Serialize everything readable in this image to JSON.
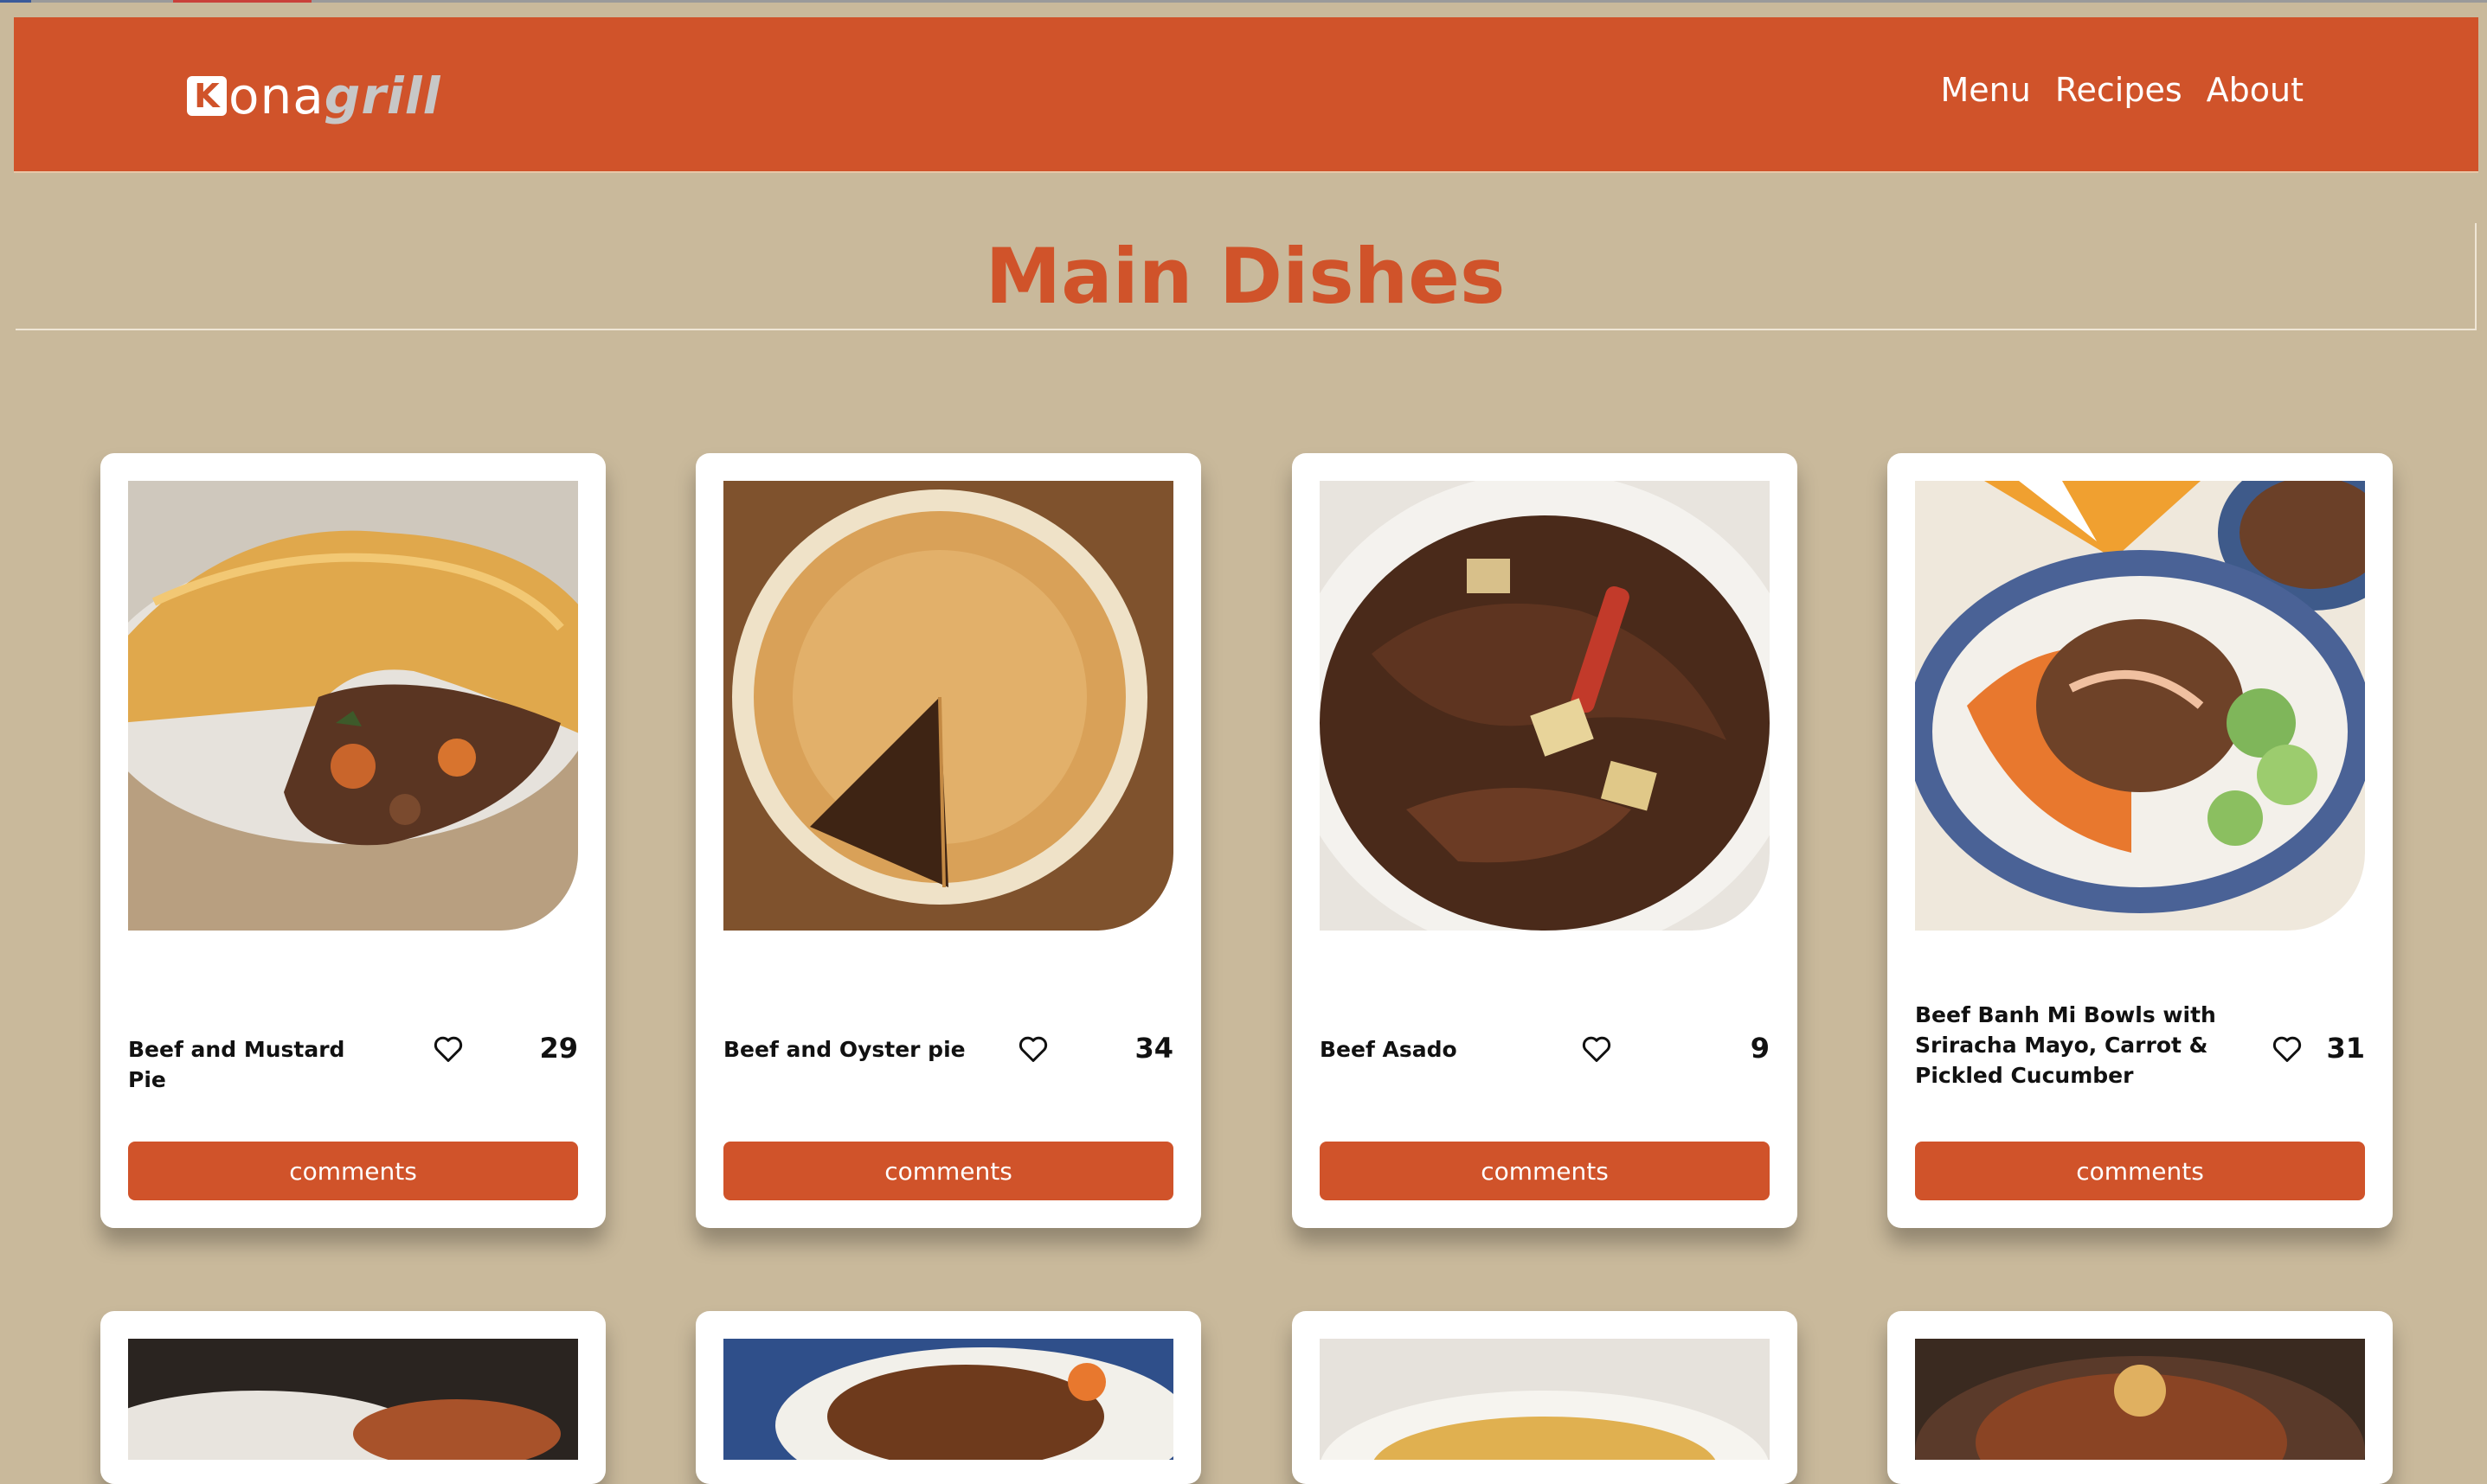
{
  "brand": {
    "logo_letter": "K",
    "logo_word": "ona",
    "logo_accent": "grill"
  },
  "nav": {
    "menu": "Menu",
    "recipes": "Recipes",
    "about": "About"
  },
  "page": {
    "title": "Main Dishes"
  },
  "colors": {
    "primary": "#d0532a",
    "background": "#c9b99b",
    "card": "#ffffff"
  },
  "recipes": [
    {
      "name": "Beef and Mustard Pie",
      "likes": "29",
      "button": "comments",
      "icon": "heart-icon"
    },
    {
      "name": "Beef and Oyster pie",
      "likes": "34",
      "button": "comments",
      "icon": "heart-icon"
    },
    {
      "name": "Beef Asado",
      "likes": "9",
      "button": "comments",
      "icon": "heart-icon"
    },
    {
      "name": "Beef Banh Mi Bowls with Sriracha Mayo, Carrot & Pickled Cucumber",
      "likes": "31",
      "button": "comments",
      "icon": "heart-icon"
    }
  ]
}
